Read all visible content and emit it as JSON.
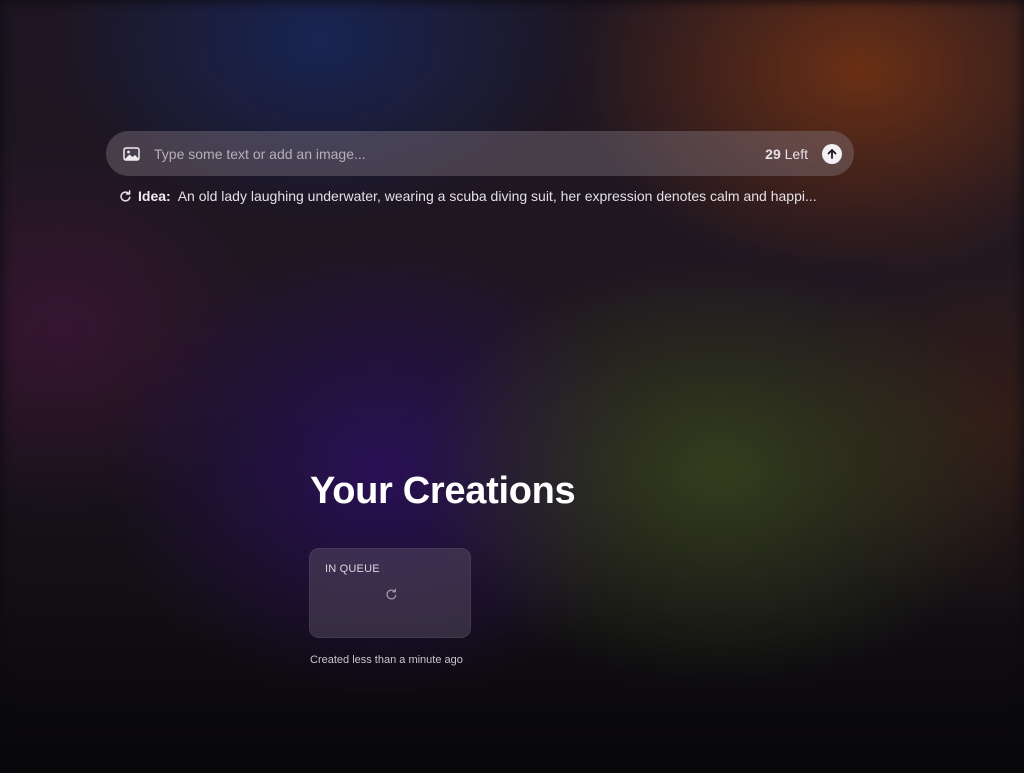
{
  "prompt": {
    "placeholder": "Type some text or add an image...",
    "value": "",
    "credits_count": "29",
    "credits_suffix": "Left",
    "image_icon": "image-icon",
    "submit_icon": "arrow-up-icon"
  },
  "idea": {
    "icon": "refresh-icon",
    "label": "Idea:",
    "text": "An old lady laughing underwater, wearing a scuba diving suit, her expression denotes calm and happi..."
  },
  "creations": {
    "title": "Your Creations",
    "items": [
      {
        "status": "IN QUEUE",
        "icon": "spinner-icon",
        "created": "Created less than a minute ago"
      }
    ]
  },
  "colors": {
    "title_text": "#ffffff",
    "body_text": "#e4e0e6",
    "placeholder_text": "#b7afb6",
    "submit_button": "#f3f0f3"
  }
}
